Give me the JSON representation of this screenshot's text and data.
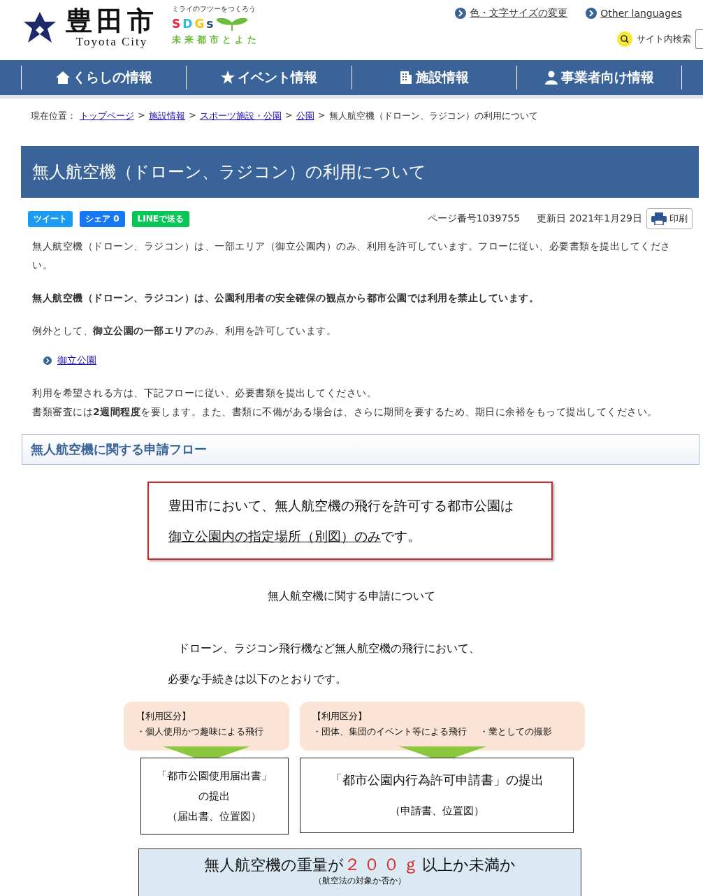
{
  "header": {
    "logo_title": "豊田市",
    "logo_subtitle": "Toyota City",
    "sdgs_tagline": "ミライのフツーをつくろう",
    "sdgs_letters": [
      {
        "char": "S",
        "color": "#e5243b"
      },
      {
        "char": "D",
        "color": "#26bde2"
      },
      {
        "char": "G",
        "color": "#fcc30b"
      },
      {
        "char": "s",
        "color": "#19486a"
      }
    ],
    "sdgs_caption": "未来都市とよた",
    "links": [
      "色・文字サイズの変更",
      "Other languages"
    ],
    "search_label": "サイト内検索"
  },
  "nav": [
    {
      "label": "くらしの情報"
    },
    {
      "label": "イベント情報"
    },
    {
      "label": "施設情報"
    },
    {
      "label": "事業者向け情報"
    }
  ],
  "breadcrumb": {
    "label": "現在位置：",
    "separator": ">",
    "links": [
      "トップページ",
      "施設情報",
      "スポーツ施設・公園",
      "公園"
    ],
    "current": "無人航空機（ドローン、ラジコン）の利用について"
  },
  "title": "無人航空機（ドローン、ラジコン）の利用について",
  "share_buttons": [
    {
      "kind": "twitter",
      "label": "ツイート"
    },
    {
      "kind": "facebook",
      "label": "シェア",
      "count": "0"
    },
    {
      "kind": "line",
      "label": "LINEで送る"
    }
  ],
  "page_number": "ページ番号1039755",
  "updated": "更新日 2021年1月29日",
  "print": "印刷",
  "content": [
    {
      "kind": "text",
      "text": "無人航空機（ドローン、ラジコン）は、一部エリア（御立公園内）のみ、利用を許可しています。フローに従い、必要書類を提出してください。"
    },
    {
      "kind": "bold",
      "text": "無人航空機（ドローン、ラジコン）は、公園利用者の安全確保の観点から都市公園では利用を禁止しています。"
    },
    {
      "kind": "text",
      "text": "例外として、**御立公園の一部エリア**のみ、利用を許可しています。"
    },
    {
      "kind": "link",
      "text": "御立公園"
    },
    {
      "kind": "lines",
      "lines": [
        "利用を希望される方は、下記フローに従い、必要書類を提出してください。",
        "書類審査には**2週間程度**を要します。また、書類に不備がある場合は、さらに期間を要するため、期日に余裕をもって提出してください。"
      ]
    }
  ],
  "section_heading": "無人航空機に関する申請フロー",
  "notice": {
    "line1": "豊田市において、無人航空機の飛行を許可する都市公園は",
    "underlined": "御立公園内の指定場所（別図）のみ",
    "rest": "です。"
  },
  "flow": {
    "heading": "無人航空機に関する申請について",
    "intro": [
      "ドローン、ラジコン飛行機など無人航空機の飛行において、",
      "必要な手続きは以下のとおりです。"
    ],
    "columns": [
      {
        "category": "【利用区分】",
        "items": [
          "・個人使用かつ趣味による飛行"
        ],
        "document": [
          "「都市公園使用届出書」",
          "の提出",
          "（届出書、位置図）"
        ]
      },
      {
        "category": "【利用区分】",
        "items": [
          "・団体、集団のイベント等による飛行",
          "・業としての撮影"
        ],
        "document": [
          "「都市公園内行為許可申請書」の提出",
          "（申請書、位置図）"
        ]
      }
    ],
    "weight": {
      "before": "無人航空機の重量が",
      "highlight": "２００ｇ",
      "after": "以上か未満か",
      "note": "（航空法の対象か否か）"
    }
  }
}
